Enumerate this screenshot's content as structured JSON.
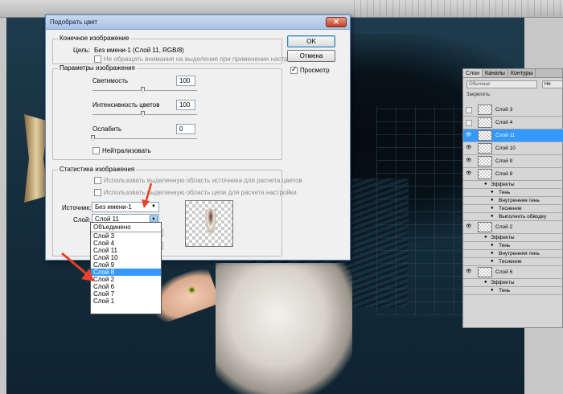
{
  "dialog": {
    "title": "Подобрать цвет",
    "close_label": "✕",
    "final_image": {
      "legend": "Конечное изображение",
      "target_label": "Цель:",
      "target_value": "Без имени-1 (Слой 11, RGB/8)",
      "ignore_selection_label": "Не обращать внимания на выделение при применении настроек"
    },
    "image_options": {
      "legend": "Параметры изображения",
      "luminance_label": "Светимость",
      "luminance_value": "100",
      "intensity_label": "Интенсивность цветов",
      "intensity_value": "100",
      "fade_label": "Ослабить",
      "fade_value": "0",
      "neutralize_label": "Нейтрализовать"
    },
    "image_stats": {
      "legend": "Статистика изображения",
      "use_source_selection_label": "Использовать выделенную область источника для расчета цветов",
      "use_target_selection_label": "Использовать выделенную область цели для расчета настройки",
      "source_label": "Источник:",
      "source_value": "Без имени-1",
      "layer_label": "Слой:",
      "layer_value": "Слой 11"
    },
    "buttons": {
      "ok": "OK",
      "cancel": "Отмена",
      "preview": "Просмотр"
    },
    "layer_dropdown": {
      "options": [
        "Объединено",
        "Слой 3",
        "Слой 4",
        "Слой 11",
        "Слой 10",
        "Слой 9",
        "Слой 8",
        "Слой 2",
        "Слой 6",
        "Слой 7",
        "Слой 1"
      ],
      "highlighted": "Слой 8"
    }
  },
  "layers_panel": {
    "tabs": [
      "Слои",
      "Каналы",
      "Контуры"
    ],
    "blend_mode": "Обычные",
    "opacity_label": "Не",
    "lock_label": "Закрепить:",
    "rows": [
      {
        "name": "Слой 3",
        "kind": "layer",
        "visible": false
      },
      {
        "name": "Слой 4",
        "kind": "layer",
        "visible": false
      },
      {
        "name": "Слой 11",
        "kind": "layer",
        "visible": true,
        "selected": true
      },
      {
        "name": "Слой 10",
        "kind": "layer",
        "visible": true
      },
      {
        "name": "Слой 9",
        "kind": "layer",
        "visible": true
      },
      {
        "name": "Слой 8",
        "kind": "layer",
        "visible": true
      },
      {
        "name": "Эффекты",
        "kind": "fx"
      },
      {
        "name": "Тень",
        "kind": "fx2"
      },
      {
        "name": "Внутренняя тень",
        "kind": "fx2"
      },
      {
        "name": "Тиснение",
        "kind": "fx2"
      },
      {
        "name": "Выполнить обводку",
        "kind": "fx2"
      },
      {
        "name": "Слой 2",
        "kind": "layer",
        "visible": true
      },
      {
        "name": "Эффекты",
        "kind": "fx"
      },
      {
        "name": "Тень",
        "kind": "fx2"
      },
      {
        "name": "Внутренняя тень",
        "kind": "fx2"
      },
      {
        "name": "Тиснение",
        "kind": "fx2"
      },
      {
        "name": "Слой 6",
        "kind": "layer",
        "visible": true
      },
      {
        "name": "Эффекты",
        "kind": "fx"
      },
      {
        "name": "Тень",
        "kind": "fx2"
      }
    ]
  },
  "colors": {
    "selection": "#3399ff",
    "annotation_arrow": "#e8402a"
  },
  "icons": {
    "eye": "eye-icon",
    "fx": "effects-icon",
    "close": "close-icon"
  }
}
